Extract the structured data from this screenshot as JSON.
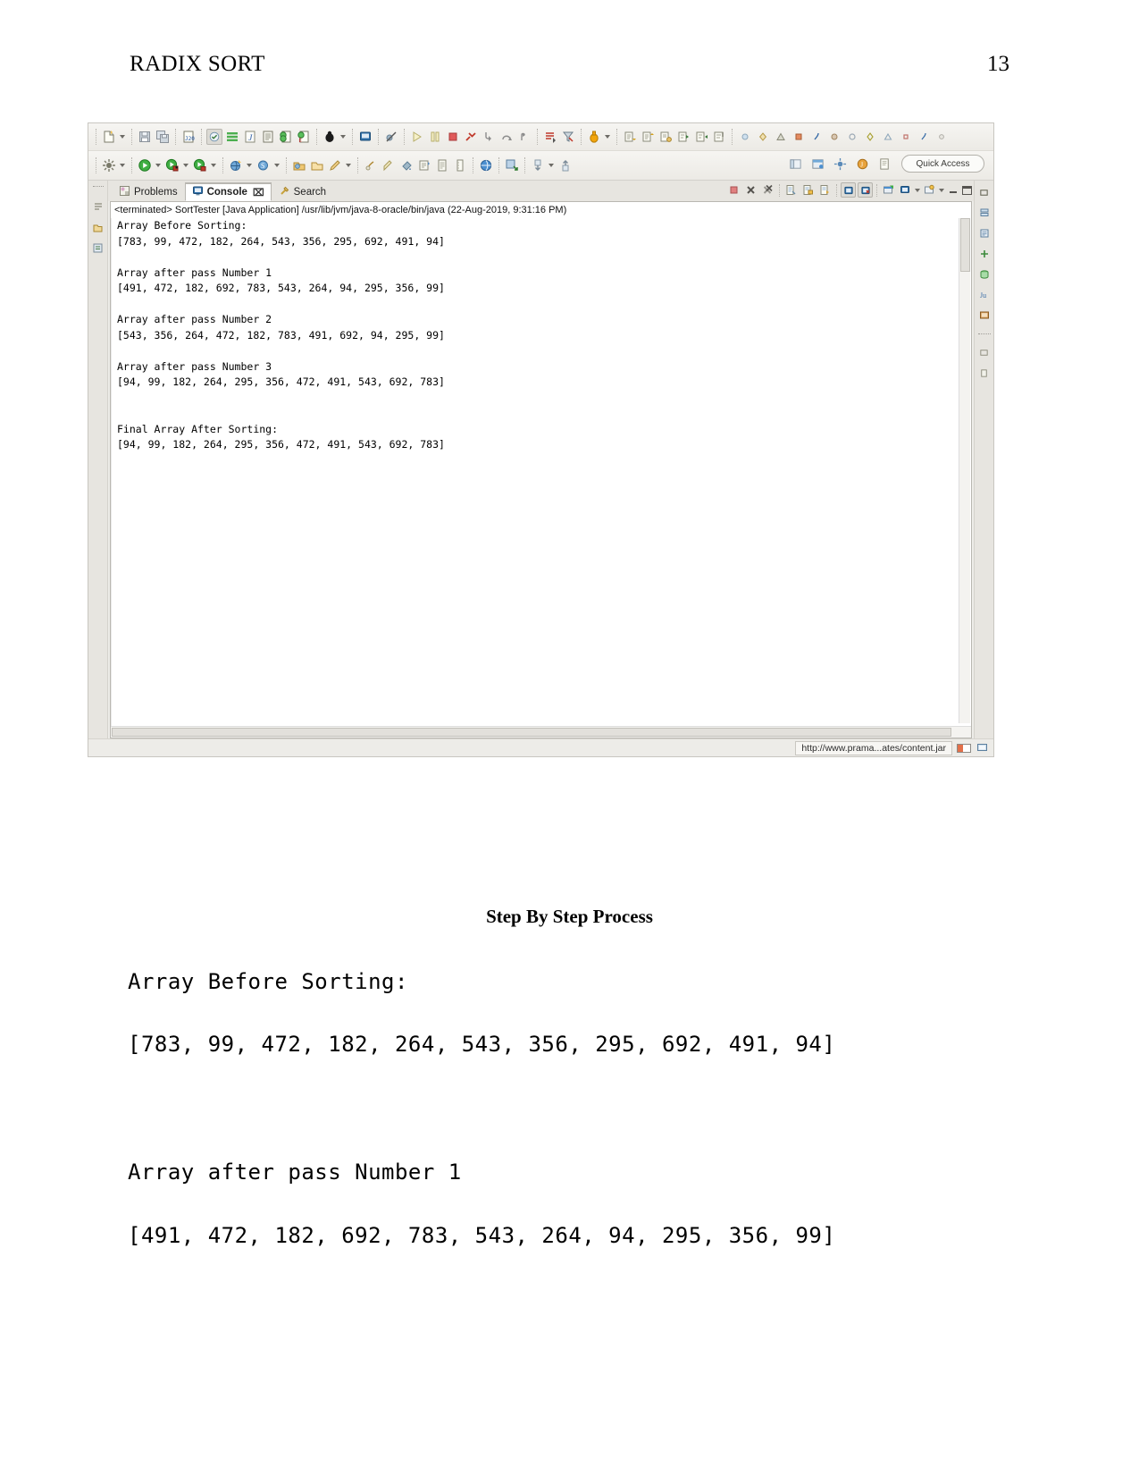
{
  "page": {
    "doc_title": "RADIX SORT",
    "page_number": "13"
  },
  "eclipse": {
    "quick_access": "Quick Access",
    "tabs": [
      {
        "label": "Problems",
        "icon": "problems-icon",
        "active": false,
        "closable": false
      },
      {
        "label": "Console",
        "icon": "console-icon",
        "active": true,
        "closable": true,
        "close_glyph": "⌧"
      },
      {
        "label": "Search",
        "icon": "search-icon",
        "active": false,
        "closable": false
      }
    ],
    "launch_line": "<terminated> SortTester [Java Application] /usr/lib/jvm/java-8-oracle/bin/java (22-Aug-2019, 9:31:16 PM)",
    "console_output": "Array Before Sorting:\n[783, 99, 472, 182, 264, 543, 356, 295, 692, 491, 94]\n\nArray after pass Number 1\n[491, 472, 182, 692, 783, 543, 264, 94, 295, 356, 99]\n\nArray after pass Number 2\n[543, 356, 264, 472, 182, 783, 491, 692, 94, 295, 99]\n\nArray after pass Number 3\n[94, 99, 182, 264, 295, 356, 472, 491, 543, 692, 783]\n\n\nFinal Array After Sorting:\n[94, 99, 182, 264, 295, 356, 472, 491, 543, 692, 783]",
    "status_text": "http://www.prama...ates/content.jar",
    "toolbar_row1_icons": [
      "new-file-icon",
      "new-dropdown-arrow",
      "save-icon",
      "save-all-icon",
      "new-java-class-icon",
      "toggle-mark-occurrences-icon",
      "open-type-icon",
      "new-java-project-icon",
      "new-package-icon",
      "new-annotation-icon",
      "new-enum-icon",
      "debug-icon",
      "debug-dropdown-arrow",
      "new-jsp-icon",
      "skip-breakpoints-icon",
      "resume-icon",
      "suspend-icon",
      "terminate-icon",
      "disconnect-icon",
      "step-into-icon",
      "step-over-icon",
      "step-return-icon",
      "drop-to-frame-icon",
      "use-step-filters-icon",
      "run-last-tool-icon",
      "run-dropdown-arrow",
      "next-annotation-icon",
      "previous-annotation-icon",
      "last-edit-location-icon",
      "back-history-icon",
      "forward-history-icon",
      "pin-editor-icon",
      "marker-icon-1",
      "marker-icon-2",
      "marker-icon-3",
      "marker-icon-4",
      "marker-icon-5",
      "marker-icon-6",
      "marker-icon-7",
      "marker-icon-8",
      "marker-icon-9",
      "marker-icon-10",
      "marker-icon-11",
      "marker-icon-12"
    ],
    "toolbar_row2_icons": [
      "debug-perspective-icon",
      "debug-dropdown-arrow-2",
      "run-icon",
      "run-dropdown-arrow-2",
      "coverage-icon",
      "coverage-dropdown-arrow",
      "profile-icon",
      "profile-dropdown-arrow",
      "new-web-project-icon",
      "web-dropdown-arrow",
      "search-global-icon",
      "search-dropdown-arrow",
      "open-perspective-icon",
      "open-folder-icon",
      "edit-icon",
      "edit-dropdown-arrow",
      "validate-icon",
      "paint-icon",
      "pour-icon",
      "external-tools-icon",
      "document-icon",
      "ruler-icon",
      "globe-icon",
      "network-icon",
      "download-icon",
      "download-dropdown-arrow",
      "upload-icon"
    ],
    "console_toolbar_icons": [
      "terminate-icon",
      "remove-launch-icon",
      "remove-all-launches-icon",
      "clear-console-icon",
      "lock-scroll-icon",
      "show-console-on-output-icon",
      "pin-console-icon",
      "display-selected-console-icon",
      "open-console-icon",
      "open-console-dropdown-arrow",
      "new-console-view-icon",
      "new-console-dropdown-arrow",
      "minimize-icon",
      "maximize-icon"
    ],
    "left_rail_icons": [
      "fast-view-icon",
      "package-explorer-icon",
      "outline-icon"
    ],
    "right_rail_icons": [
      "restore-icon",
      "servers-icon",
      "properties-icon",
      "snippets-icon",
      "junit-icon",
      "data-source-icon",
      "console-small-icon",
      "progress-icon"
    ]
  },
  "document": {
    "section_heading": "Step By Step Process",
    "lines": [
      "Array Before Sorting:",
      "[783, 99, 472, 182, 264, 543, 356, 295, 692, 491, 94]",
      "Array after pass Number 1",
      "[491, 472, 182, 692, 783, 543, 264, 94, 295, 356, 99]"
    ]
  }
}
